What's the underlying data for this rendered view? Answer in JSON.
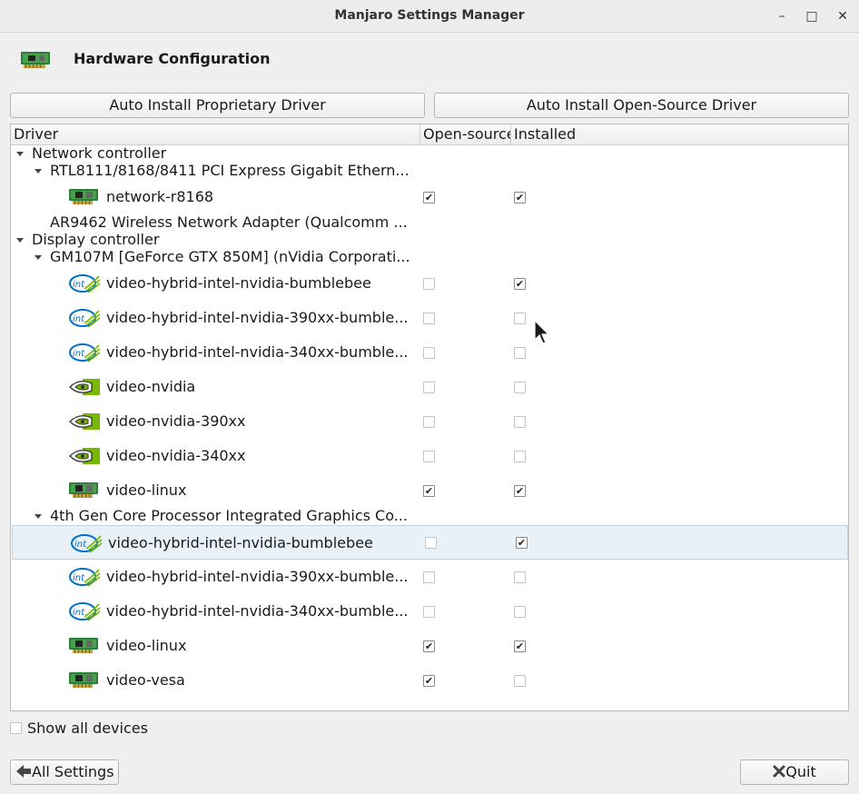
{
  "window": {
    "title": "Manjaro Settings Manager",
    "minimize_glyph": "–",
    "maximize_glyph": "□",
    "close_glyph": "✕"
  },
  "header": {
    "title": "Hardware Configuration",
    "icon": "network-card-icon"
  },
  "toolbar": {
    "auto_proprietary_label": "Auto Install Proprietary Driver",
    "auto_opensource_label": "Auto Install Open-Source Driver"
  },
  "tree": {
    "columns": [
      "Driver",
      "Open-source",
      "Installed"
    ],
    "rows": [
      {
        "level": 0,
        "kind": "group",
        "expanded": true,
        "label": "Network controller"
      },
      {
        "level": 1,
        "kind": "device",
        "expanded": true,
        "label": "RTL8111/8168/8411 PCI Express Gigabit Ethern..."
      },
      {
        "level": 2,
        "kind": "driver",
        "icon": "pci-card-icon",
        "label": "network-r8168",
        "open_source": true,
        "installed": true
      },
      {
        "level": 1,
        "kind": "device",
        "expanded": false,
        "label": "AR9462 Wireless Network Adapter (Qualcomm ..."
      },
      {
        "level": 0,
        "kind": "group",
        "expanded": true,
        "label": "Display controller"
      },
      {
        "level": 1,
        "kind": "device",
        "expanded": true,
        "label": "GM107M [GeForce GTX 850M] (nVidia Corporati..."
      },
      {
        "level": 2,
        "kind": "driver",
        "icon": "intel-logo-icon",
        "label": "video-hybrid-intel-nvidia-bumblebee",
        "open_source": false,
        "installed": true
      },
      {
        "level": 2,
        "kind": "driver",
        "icon": "intel-logo-icon",
        "label": "video-hybrid-intel-nvidia-390xx-bumble...",
        "open_source": false,
        "installed": false
      },
      {
        "level": 2,
        "kind": "driver",
        "icon": "intel-logo-icon",
        "label": "video-hybrid-intel-nvidia-340xx-bumble...",
        "open_source": false,
        "installed": false
      },
      {
        "level": 2,
        "kind": "driver",
        "icon": "nvidia-logo-icon",
        "label": "video-nvidia",
        "open_source": false,
        "installed": false
      },
      {
        "level": 2,
        "kind": "driver",
        "icon": "nvidia-logo-icon",
        "label": "video-nvidia-390xx",
        "open_source": false,
        "installed": false
      },
      {
        "level": 2,
        "kind": "driver",
        "icon": "nvidia-logo-icon",
        "label": "video-nvidia-340xx",
        "open_source": false,
        "installed": false
      },
      {
        "level": 2,
        "kind": "driver",
        "icon": "pci-card-icon",
        "label": "video-linux",
        "open_source": true,
        "installed": true
      },
      {
        "level": 1,
        "kind": "device",
        "expanded": true,
        "label": "4th Gen Core Processor Integrated Graphics Co..."
      },
      {
        "level": 2,
        "kind": "driver",
        "icon": "intel-logo-icon",
        "label": "video-hybrid-intel-nvidia-bumblebee",
        "open_source": false,
        "installed": true,
        "selected": true
      },
      {
        "level": 2,
        "kind": "driver",
        "icon": "intel-logo-icon",
        "label": "video-hybrid-intel-nvidia-390xx-bumble...",
        "open_source": false,
        "installed": false
      },
      {
        "level": 2,
        "kind": "driver",
        "icon": "intel-logo-icon",
        "label": "video-hybrid-intel-nvidia-340xx-bumble...",
        "open_source": false,
        "installed": false
      },
      {
        "level": 2,
        "kind": "driver",
        "icon": "pci-card-icon",
        "label": "video-linux",
        "open_source": true,
        "installed": true
      },
      {
        "level": 2,
        "kind": "driver",
        "icon": "pci-card-icon",
        "label": "video-vesa",
        "open_source": true,
        "installed": false
      }
    ]
  },
  "show_all": {
    "label": "Show all devices",
    "checked": false
  },
  "footer": {
    "all_settings_label": "All Settings",
    "quit_label": "Quit"
  },
  "colors": {
    "selection": "#e8f1f8",
    "nvidia_green": "#76b900",
    "intel_blue": "#0071c5",
    "card_green": "#3e8e3e"
  }
}
